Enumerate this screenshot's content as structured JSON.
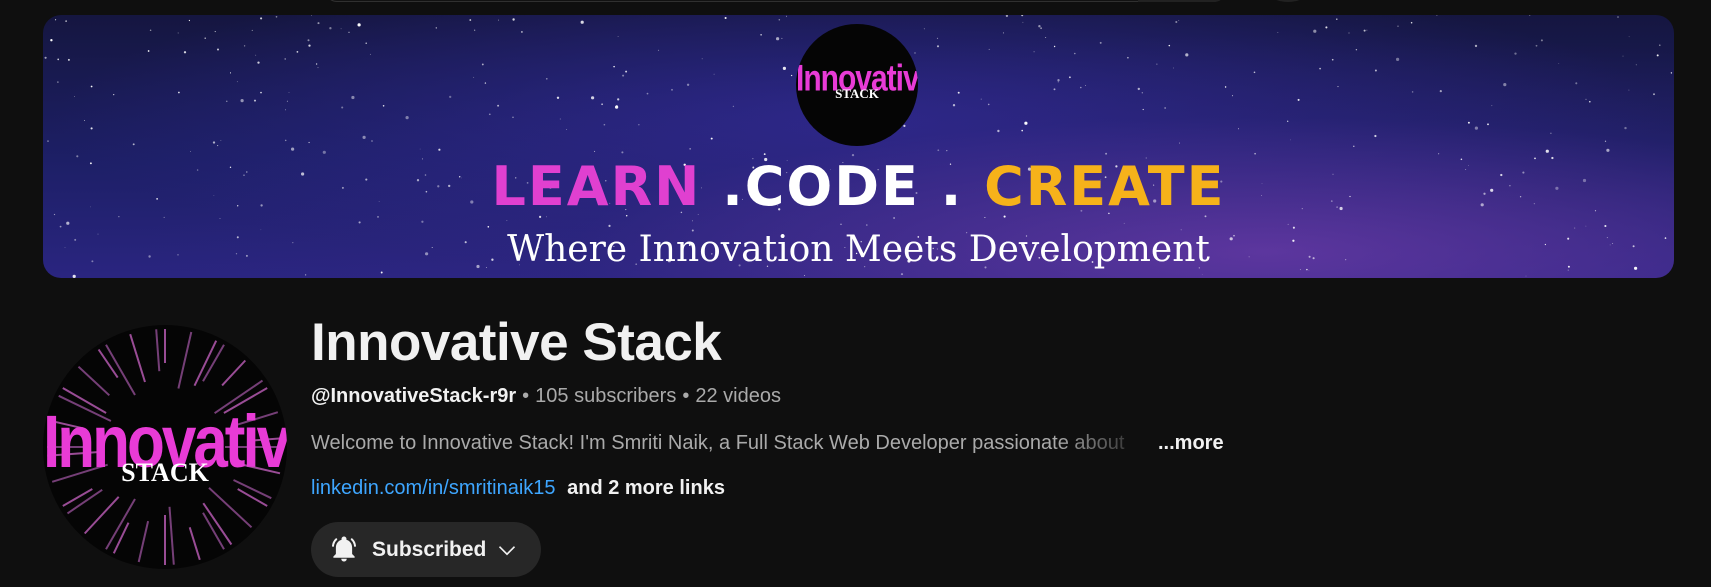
{
  "banner": {
    "logo_word": "Innovative",
    "logo_sub": "STACK",
    "tagline_part1": "LEARN",
    "tagline_part2": ".CODE .",
    "tagline_part3": "CREATE",
    "subtitle": "Where Innovation Meets Development"
  },
  "avatar": {
    "word": "Innovative",
    "sub": "STACK"
  },
  "channel": {
    "name": "Innovative Stack",
    "handle": "@InnovativeStack-r9r",
    "separator": "•",
    "subscribers": "105 subscribers",
    "videos": "22 videos",
    "description": "Welcome to Innovative Stack! I'm Smriti Naik, a Full Stack Web Developer passionate about",
    "more_label": "...more",
    "link": "linkedin.com/in/smritinaik15",
    "more_links": "and 2 more links"
  },
  "subscribe_button": {
    "label": "Subscribed"
  },
  "colors": {
    "background": "#0f0f0f",
    "link": "#3ea6ff",
    "brand_pink": "#e83bd6",
    "brand_yellow": "#f6b21a",
    "button_bg": "#272727"
  },
  "icons": {
    "bell": "notifications-active-icon",
    "chevron": "chevron-down-icon"
  }
}
